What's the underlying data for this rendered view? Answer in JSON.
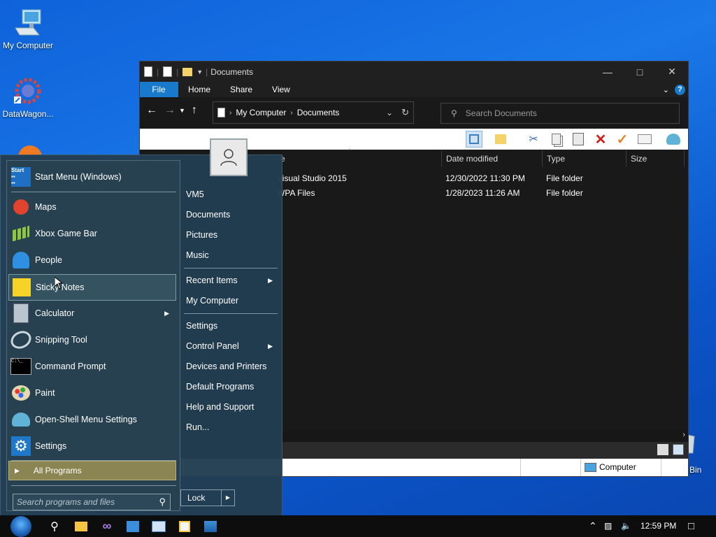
{
  "desktop": {
    "icons": [
      {
        "label": "My Computer"
      },
      {
        "label": "DataWagon..."
      },
      {
        "label": "Bin"
      }
    ]
  },
  "explorer": {
    "title": "Documents",
    "tabs": [
      {
        "label": "File"
      },
      {
        "label": "Home"
      },
      {
        "label": "Share"
      },
      {
        "label": "View"
      }
    ],
    "breadcrumb": [
      {
        "label": "My Computer"
      },
      {
        "label": "Documents"
      }
    ],
    "search_placeholder": "Search Documents",
    "columns": [
      {
        "label": "e"
      },
      {
        "label": "Date modified"
      },
      {
        "label": "Type"
      },
      {
        "label": "Size"
      }
    ],
    "rows": [
      {
        "name": "Visual Studio 2015",
        "date": "12/30/2022 11:30 PM",
        "type": "File folder"
      },
      {
        "name": "WPA Files",
        "date": "1/28/2023 11:26 AM",
        "type": "File folder"
      }
    ],
    "status_location": "Computer"
  },
  "startmenu": {
    "left_items": [
      {
        "label": "Start Menu (Windows)"
      },
      {
        "label": "Maps"
      },
      {
        "label": "Xbox Game Bar"
      },
      {
        "label": "People"
      },
      {
        "label": "Sticky Notes"
      },
      {
        "label": "Calculator"
      },
      {
        "label": "Snipping Tool"
      },
      {
        "label": "Command Prompt"
      },
      {
        "label": "Paint"
      },
      {
        "label": "Open-Shell Menu Settings"
      },
      {
        "label": "Settings"
      }
    ],
    "all_programs": "All Programs",
    "search_placeholder": "Search programs and files",
    "right_items": [
      {
        "label": "VM5"
      },
      {
        "label": "Documents"
      },
      {
        "label": "Pictures"
      },
      {
        "label": "Music"
      },
      {
        "label": "Recent Items"
      },
      {
        "label": "My Computer"
      },
      {
        "label": "Settings"
      },
      {
        "label": "Control Panel"
      },
      {
        "label": "Devices and Printers"
      },
      {
        "label": "Default Programs"
      },
      {
        "label": "Help and Support"
      },
      {
        "label": "Run..."
      }
    ],
    "lock_label": "Lock"
  },
  "taskbar": {
    "clock": "12:59 PM"
  },
  "colors": {
    "accent": "#1979ca",
    "startmenu_bg": "#233e52",
    "highlight": "#8a8552"
  }
}
